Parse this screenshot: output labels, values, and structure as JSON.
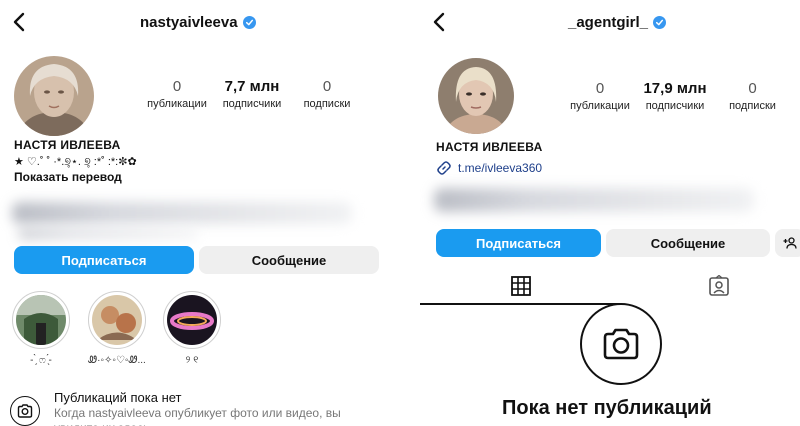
{
  "left": {
    "handle": "nastyaivleeva",
    "stats": [
      {
        "value": "0",
        "label": "публикации"
      },
      {
        "value": "7,7 млн",
        "label": "подписчики"
      },
      {
        "value": "0",
        "label": "подписки"
      }
    ],
    "name": "НАСТЯ ИВЛЕЕВА",
    "bio": "★ ♡.˚ ˚ ·*.୭̥⋆. ୭̥ :*˚ :*:✼✿",
    "translate": "Показать перевод",
    "follow_label": "Подписаться",
    "message_label": "Сообщение",
    "highlights": [
      {
        "label": "- ̗̀ ෆ ̖́-"
      },
      {
        "label": "Ꮺ·◦✧◦♡◦Ꮺ..."
      },
      {
        "label": "୨ ୧"
      }
    ],
    "no_posts_title": "Публикаций пока нет",
    "no_posts_sub": "Когда nastyaivleeva опубликует фото или видео, вы увидите их здесь."
  },
  "right": {
    "handle": "_agentgirl_",
    "stats": [
      {
        "value": "0",
        "label": "публикации"
      },
      {
        "value": "17,9 млн",
        "label": "подписчики"
      },
      {
        "value": "0",
        "label": "подписки"
      }
    ],
    "name": "НАСТЯ ИВЛЕЕВА",
    "link": "t.me/ivleeva360",
    "follow_label": "Подписаться",
    "message_label": "Сообщение",
    "no_posts_title": "Пока нет публикаций"
  },
  "colors": {
    "accent": "#1a9bf0",
    "secondary_btn": "#efefef",
    "verified": "#3797f0",
    "link": "#1e3f8a"
  },
  "icons": [
    "back-arrow-icon",
    "verified-badge-icon",
    "camera-icon",
    "grid-icon",
    "tagged-icon",
    "add-person-icon",
    "link-icon"
  ]
}
